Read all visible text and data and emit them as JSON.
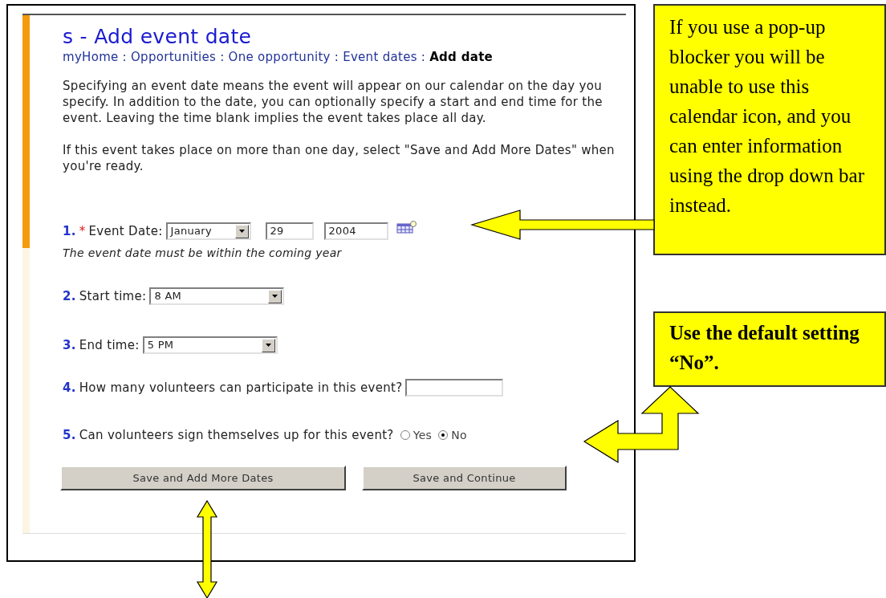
{
  "page": {
    "title": "s - Add event date",
    "breadcrumb": [
      {
        "label": "myHome",
        "current": false,
        "separator": ":"
      },
      {
        "label": "Opportunities",
        "current": false,
        "separator": ":"
      },
      {
        "label": "One opportunity",
        "current": false,
        "separator": ":"
      },
      {
        "label": "Event dates",
        "current": false,
        "separator": ":"
      },
      {
        "label": "Add date",
        "current": true
      }
    ],
    "intro": [
      "Specifying an event date means the event will appear on our calendar on the day you specify. In addition to the date, you can optionally specify a start and end time for the event. Leaving the time blank implies the event takes place all day.",
      "If this event takes place on more than one day, select \"Save and Add More Dates\" when you're ready."
    ],
    "fields": [
      {
        "kind": "date",
        "number": "1.",
        "required_mark": "*",
        "label": "Event Date:",
        "month": "January",
        "day": "29",
        "year": "2004",
        "hint": "The event date must be within the coming year"
      },
      {
        "kind": "select",
        "number": "2.",
        "label": "Start time:",
        "value": "8 AM"
      },
      {
        "kind": "select",
        "number": "3.",
        "label": "End time:",
        "value": "5 PM"
      },
      {
        "kind": "text",
        "number": "4.",
        "label": "How many volunteers can participate in this event?"
      },
      {
        "kind": "radio",
        "number": "5.",
        "label": "Can volunteers sign themselves up for this event?",
        "options": [
          {
            "label": "Yes",
            "selected": false
          },
          {
            "label": "No",
            "selected": true
          }
        ]
      }
    ],
    "buttons": [
      "Save and Add More Dates",
      "Save and Continue"
    ]
  },
  "callouts": [
    {
      "text": "If you use a pop-up blocker you will be unable to use this calendar icon, and you can enter information using the drop down bar instead.",
      "bold": false
    },
    {
      "text": "Use the default setting “No”.",
      "bold": true
    }
  ]
}
